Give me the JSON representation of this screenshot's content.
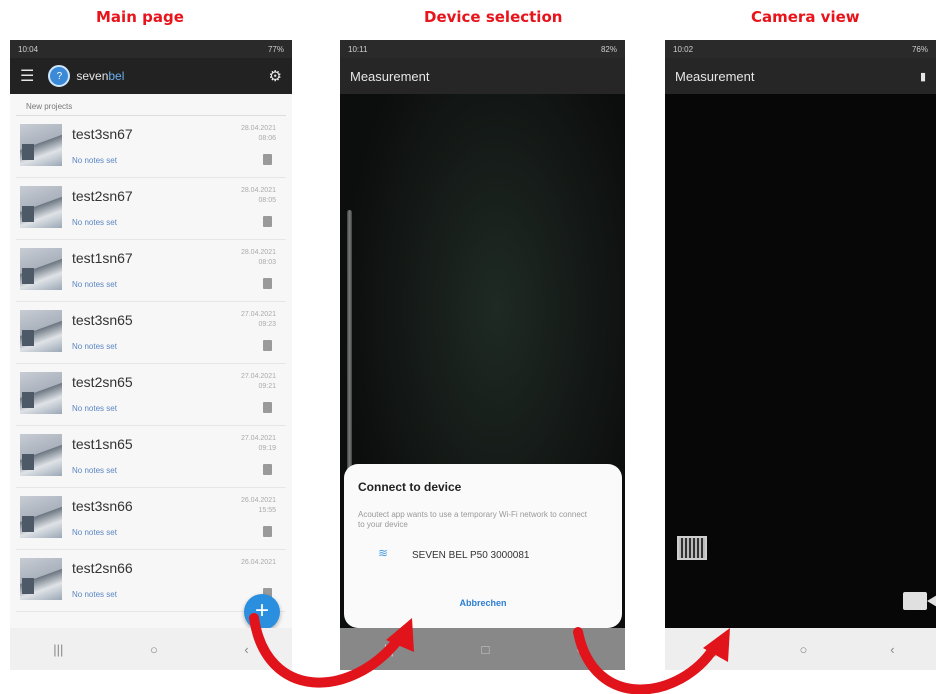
{
  "titles": {
    "main_page": "Main page",
    "device_selection": "Device selection",
    "camera_view": "Camera view"
  },
  "colors": {
    "title_red": "#e8141b",
    "accent_blue": "#2b8fe0",
    "arrow_red": "#e0141a"
  },
  "phone1": {
    "status_time": "10:04",
    "status_right": "77%",
    "logo_seven": "seven",
    "logo_bel": "bel",
    "icons": [
      "menu-icon",
      "gear-icon"
    ],
    "section_label": "New projects",
    "rows": [
      {
        "name": "test3sn67",
        "note": "No notes set",
        "date": "28.04.2021",
        "time": "08:06"
      },
      {
        "name": "test2sn67",
        "note": "No notes set",
        "date": "28.04.2021",
        "time": "08:05"
      },
      {
        "name": "test1sn67",
        "note": "No notes set",
        "date": "28.04.2021",
        "time": "08:03"
      },
      {
        "name": "test3sn65",
        "note": "No notes set",
        "date": "27.04.2021",
        "time": "09:23"
      },
      {
        "name": "test2sn65",
        "note": "No notes set",
        "date": "27.04.2021",
        "time": "09:21"
      },
      {
        "name": "test1sn65",
        "note": "No notes set",
        "date": "27.04.2021",
        "time": "09:19"
      },
      {
        "name": "test3sn66",
        "note": "No notes set",
        "date": "26.04.2021",
        "time": "15:55"
      },
      {
        "name": "test2sn66",
        "note": "No notes set",
        "date": "26.04.2021",
        "time": ""
      }
    ],
    "fab_label": "+"
  },
  "phone2": {
    "status_time": "10:11",
    "status_right": "82%",
    "appbar_title": "Measurement",
    "dialog_title": "Connect to device",
    "dialog_desc": "Acoutect app wants to use a temporary Wi-Fi network to connect to your device",
    "device_name": "SEVEN BEL P50 3000081",
    "cancel_label": "Abbrechen"
  },
  "phone3": {
    "status_time": "10:02",
    "status_right": "76%",
    "appbar_title": "Measurement"
  }
}
